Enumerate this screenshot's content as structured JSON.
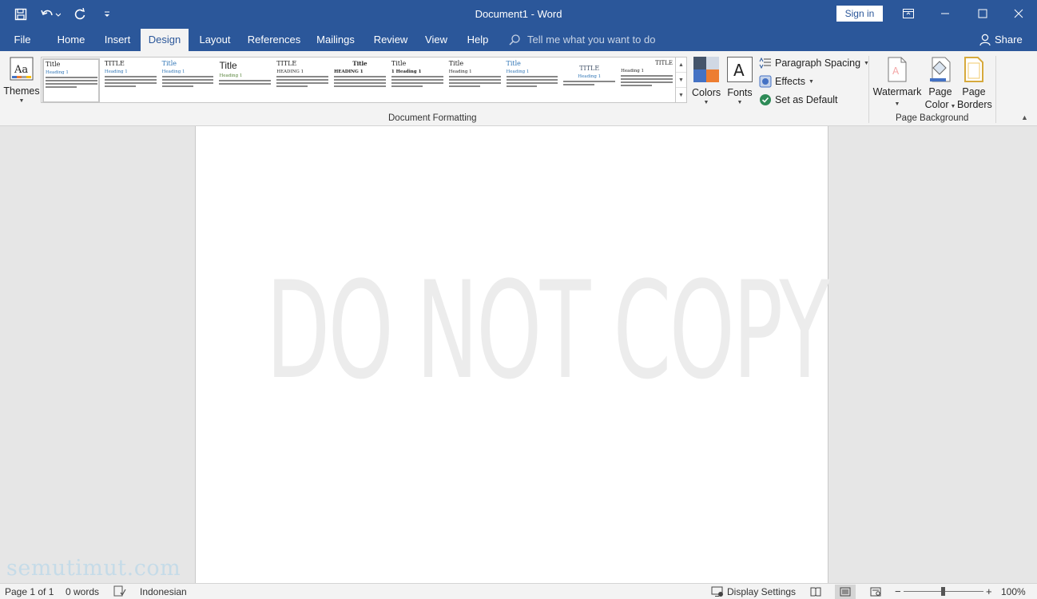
{
  "window": {
    "title": "Document1  -  Word",
    "sign_in": "Sign in"
  },
  "tabs": [
    {
      "label": "File"
    },
    {
      "label": "Home"
    },
    {
      "label": "Insert"
    },
    {
      "label": "Design",
      "active": true
    },
    {
      "label": "Layout"
    },
    {
      "label": "References"
    },
    {
      "label": "Mailings"
    },
    {
      "label": "Review"
    },
    {
      "label": "View"
    },
    {
      "label": "Help"
    }
  ],
  "tell_me": {
    "placeholder": "Tell me what you want to do"
  },
  "share": {
    "label": "Share"
  },
  "ribbon": {
    "themes_label": "Themes",
    "themes_icon_text": "Aa",
    "gallery": [
      {
        "title": "Title",
        "heading": "Heading 1"
      },
      {
        "title": "TITLE",
        "heading": "Heading 1"
      },
      {
        "title": "Title",
        "heading": "Heading 1"
      },
      {
        "title": "Title",
        "heading": "Heading 1"
      },
      {
        "title": "TITLE",
        "heading": "HEADING 1"
      },
      {
        "title": "Title",
        "heading": "HEADING 1"
      },
      {
        "title": "Title",
        "heading": "1   Heading 1"
      },
      {
        "title": "Title",
        "heading": "Heading 1"
      },
      {
        "title": "Title",
        "heading": "Heading 1"
      },
      {
        "title": "TITLE",
        "heading": "Heading 1"
      },
      {
        "title": "TITLE",
        "heading": "Heading 1"
      }
    ],
    "colors_label": "Colors",
    "fonts_label": "Fonts",
    "fonts_icon_text": "A",
    "paragraph_spacing": "Paragraph Spacing",
    "effects": "Effects",
    "set_as_default": "Set as Default",
    "document_formatting": "Document Formatting",
    "watermark": "Watermark",
    "page_color_1": "Page",
    "page_color_2": "Color",
    "page_borders_1": "Page",
    "page_borders_2": "Borders",
    "page_background": "Page Background",
    "colors": {
      "accent": "#2b579a",
      "swatch1": "#44546a",
      "swatch2": "#d0d8e4",
      "swatch3": "#4472c4",
      "swatch4": "#ed7d31"
    }
  },
  "document": {
    "watermark_text": "DO NOT COPY",
    "site_watermark": "semutimut.com"
  },
  "status": {
    "page": "Page 1 of 1",
    "words": "0 words",
    "language": "Indonesian",
    "display_settings": "Display Settings",
    "zoom": "100%"
  }
}
